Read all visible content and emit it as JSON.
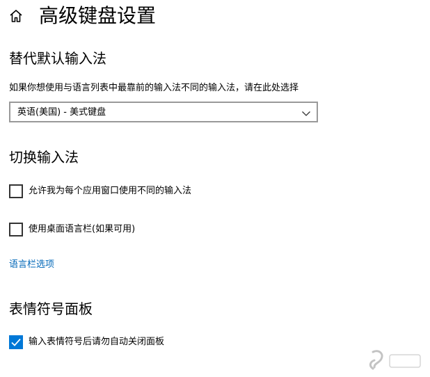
{
  "header": {
    "home_icon": "home-icon",
    "title": "高级键盘设置"
  },
  "default_input": {
    "heading": "替代默认输入法",
    "description": "如果你想使用与语言列表中最靠前的输入法不同的输入法，请在此处选择",
    "selected_value": "英语(美国) - 美式键盘",
    "chevron_icon": "chevron-down-icon"
  },
  "switch_input": {
    "heading": "切换输入法",
    "options": [
      {
        "label": "允许我为每个应用窗口使用不同的输入法",
        "checked": false
      },
      {
        "label": "使用桌面语言栏(如果可用)",
        "checked": false
      }
    ],
    "language_bar_link": "语言栏选项"
  },
  "emoji_panel": {
    "heading": "表情符号面板",
    "options": [
      {
        "label": "输入表情符号后请勿自动关闭面板",
        "checked": true
      }
    ]
  },
  "colors": {
    "accent": "#0078d7",
    "link": "#0067b8"
  }
}
